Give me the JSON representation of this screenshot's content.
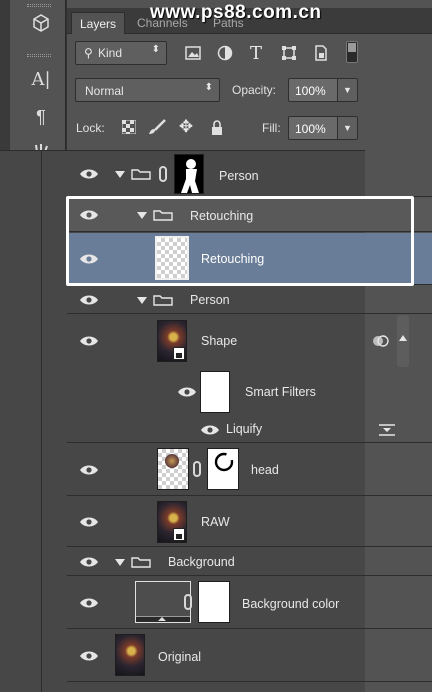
{
  "watermark": "www.ps88.com.cn",
  "tabs": [
    {
      "label": "Layers",
      "active": true
    },
    {
      "label": "Channels",
      "active": false
    },
    {
      "label": "Paths",
      "active": false
    }
  ],
  "filter": {
    "kind_label": "Kind"
  },
  "blend": {
    "mode": "Normal",
    "opacity_label": "Opacity:",
    "opacity_value": "100%"
  },
  "lock": {
    "label": "Lock:",
    "fill_label": "Fill:",
    "fill_value": "100%"
  },
  "layers": [
    {
      "name": "Person",
      "type": "group-with-mask"
    },
    {
      "name": "Retouching",
      "type": "group"
    },
    {
      "name": "Retouching",
      "type": "layer",
      "selected": true
    },
    {
      "name": "Person",
      "type": "group"
    },
    {
      "name": "Shape",
      "type": "smart-object"
    },
    {
      "name": "Smart Filters",
      "type": "smart-filters"
    },
    {
      "name": "Liquify",
      "type": "filter"
    },
    {
      "name": "head",
      "type": "layer-with-mask"
    },
    {
      "name": "RAW",
      "type": "smart-object"
    },
    {
      "name": "Background",
      "type": "group"
    },
    {
      "name": "Background color",
      "type": "fill-with-mask"
    },
    {
      "name": "Original",
      "type": "layer"
    }
  ],
  "colors": {
    "selected_row": "#6a7d98",
    "panel": "#535353",
    "layers_bg": "#474747",
    "highlight_box": "#ffffff"
  }
}
